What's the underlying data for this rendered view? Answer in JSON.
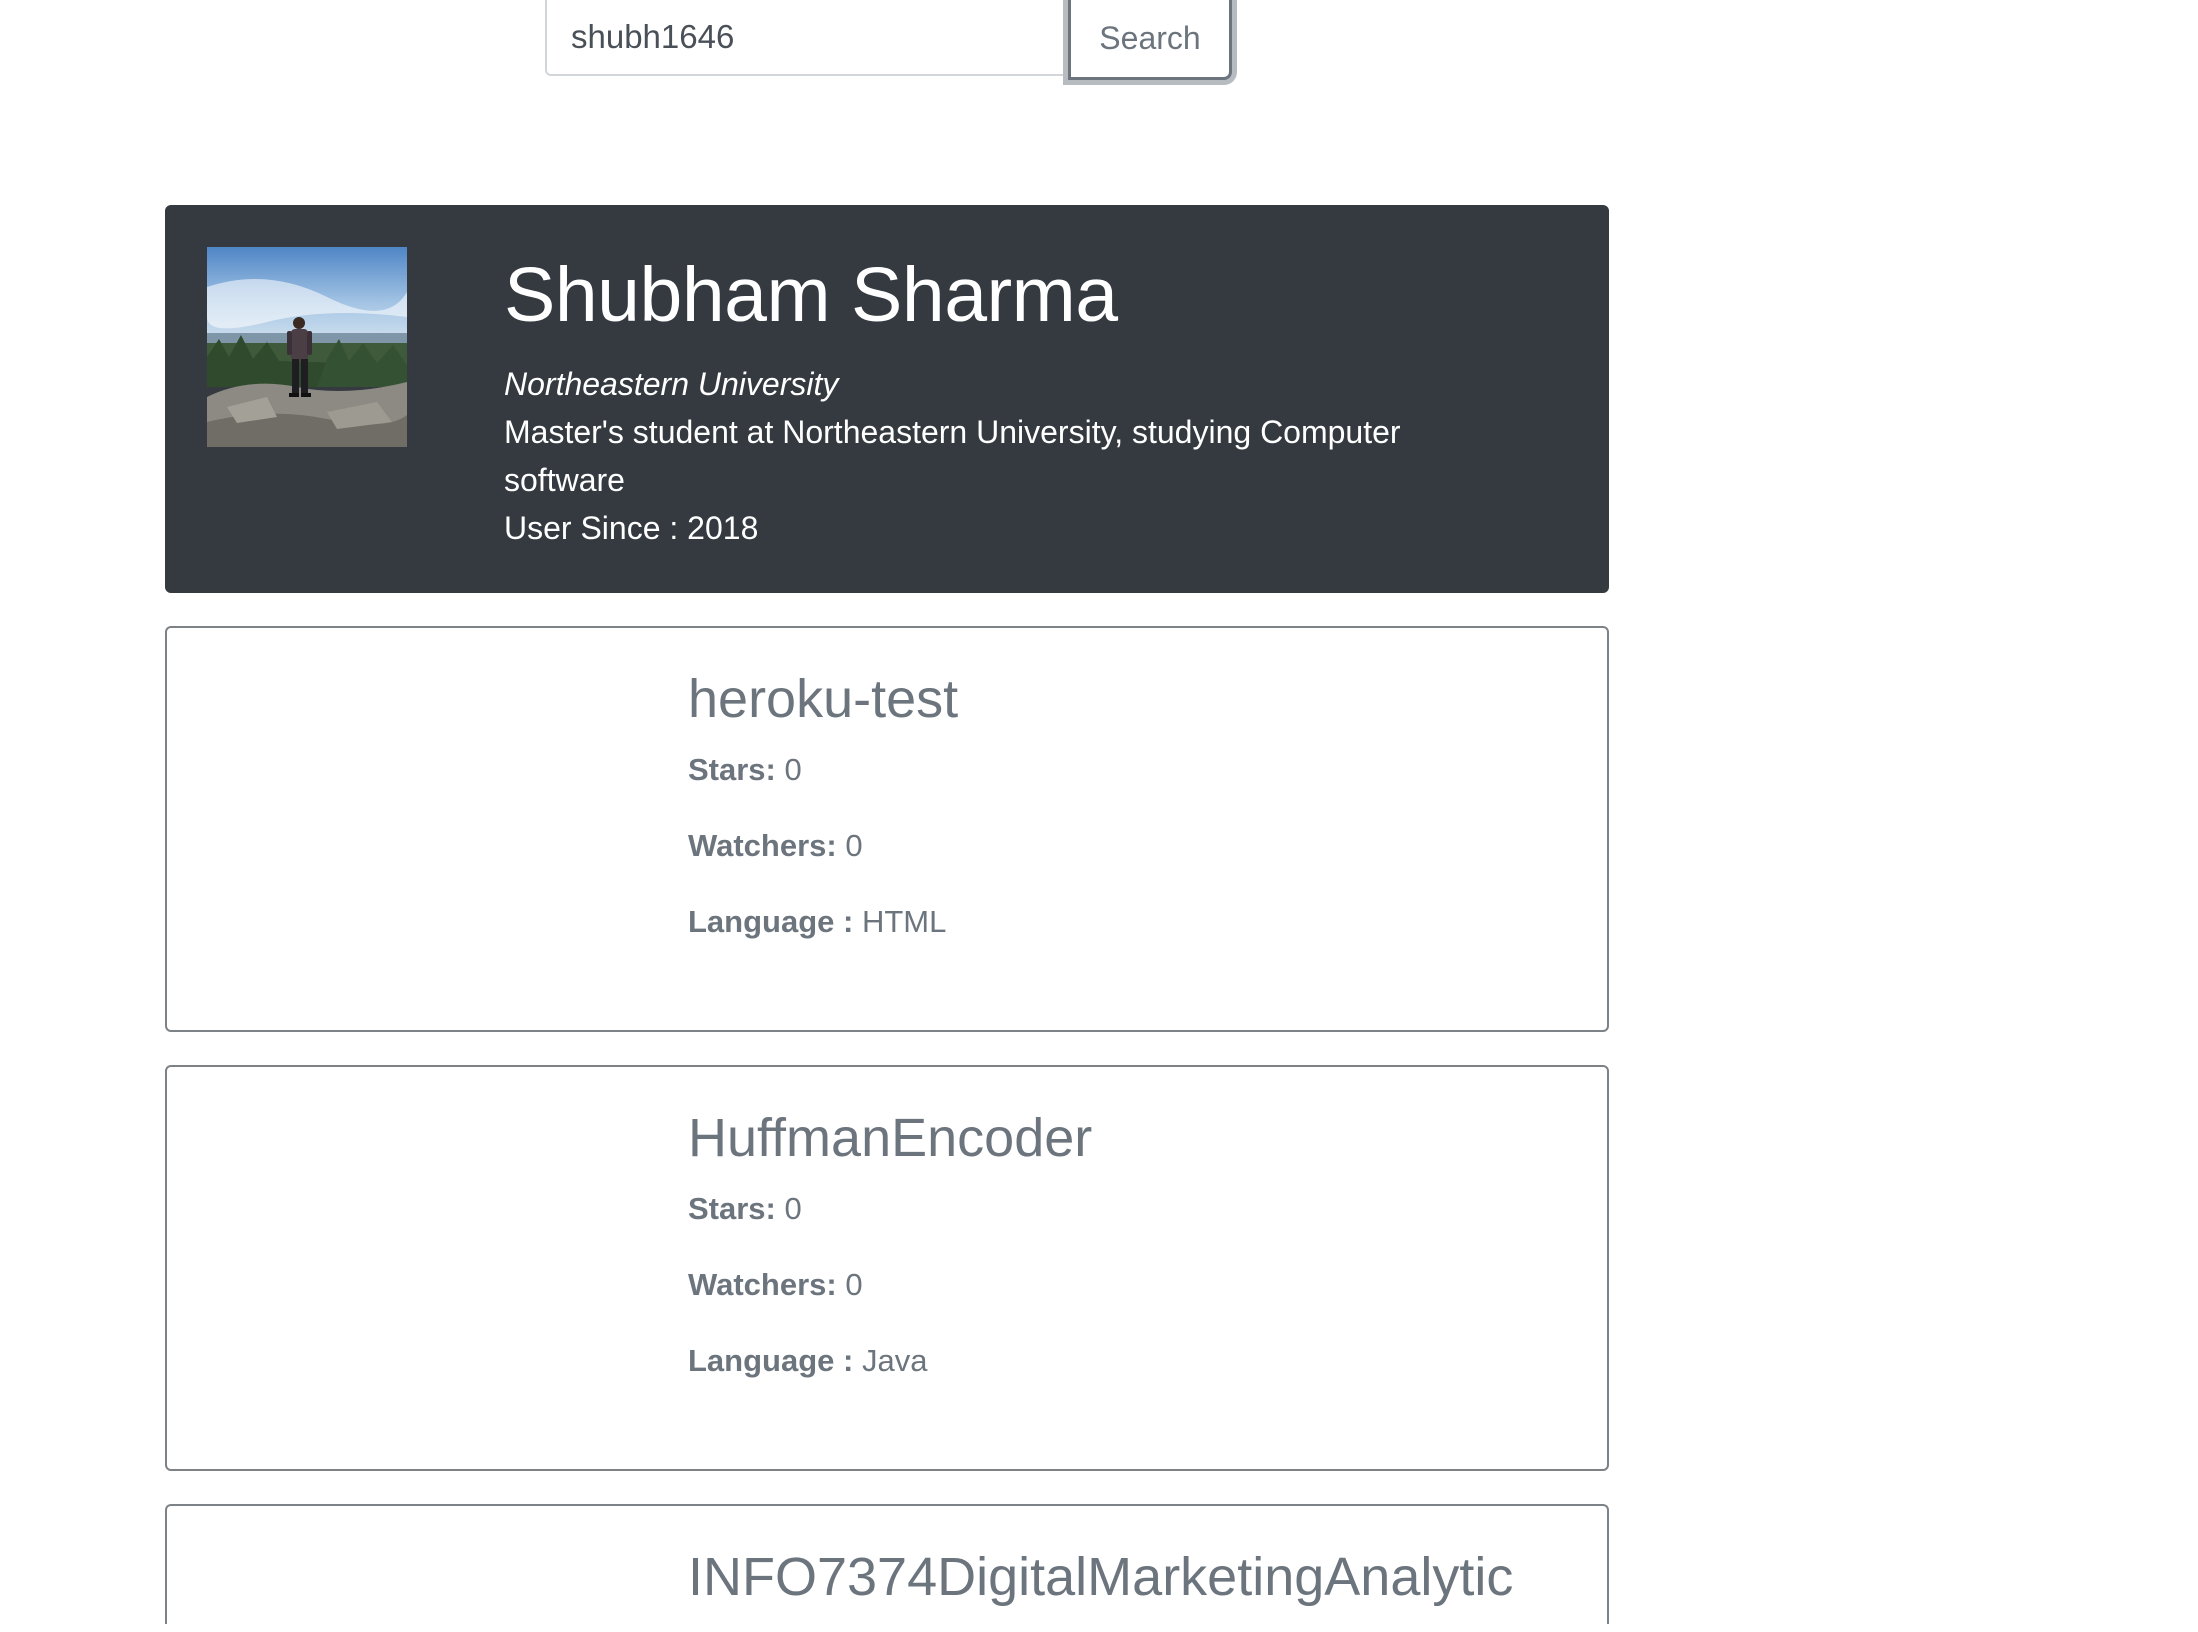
{
  "search": {
    "value": "shubh1646",
    "button_label": "Search"
  },
  "profile": {
    "name": "Shubham Sharma",
    "company": "Northeastern University",
    "bio": "Master's student at Northeastern University, studying Computer software",
    "user_since_label": "User Since :",
    "user_since_value": "2018"
  },
  "labels": {
    "stars": "Stars:",
    "watchers": "Watchers:",
    "language": "Language :"
  },
  "repos": [
    {
      "name": "heroku-test",
      "stars": "0",
      "watchers": "0",
      "language": "HTML"
    },
    {
      "name": "HuffmanEncoder",
      "stars": "0",
      "watchers": "0",
      "language": "Java"
    },
    {
      "name": "INFO7374DigitalMarketingAnalytic"
    }
  ],
  "colors": {
    "profile_bg": "#343a40",
    "repo_text": "#6c757d",
    "card_border": "#7d8287"
  }
}
